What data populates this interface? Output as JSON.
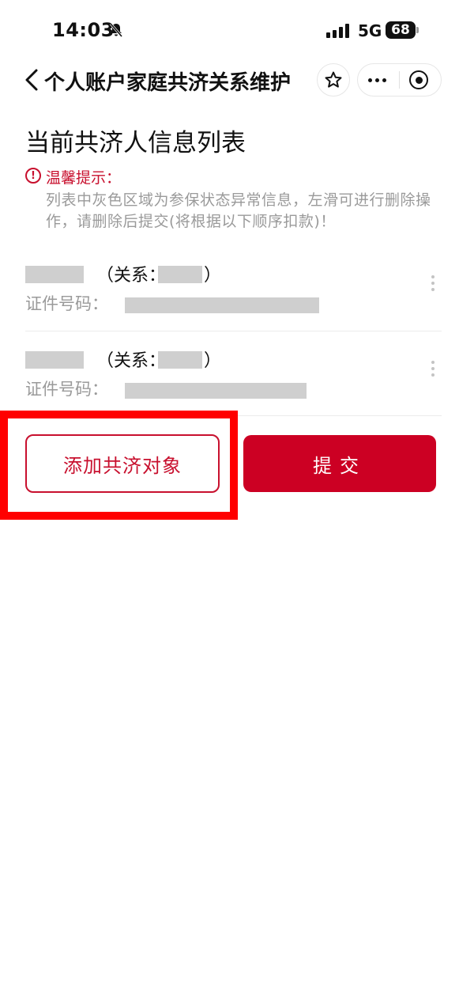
{
  "status_bar": {
    "time": "14:03",
    "network": "5G",
    "battery": "68"
  },
  "nav": {
    "title": "个人账户家庭共济关系维护"
  },
  "main": {
    "title": "当前共济人信息列表",
    "tip_title": "温馨提示：",
    "tip_body": "列表中灰色区域为参保状态异常信息，左滑可进行删除操作，请删除后提交(将根据以下顺序扣款)！",
    "members": [
      {
        "relation_prefix": "（关系：",
        "relation_suffix": "）",
        "id_label": "证件号码："
      },
      {
        "relation_prefix": "（关系：",
        "relation_suffix": "）",
        "id_label": "证件号码："
      }
    ],
    "add_button": "添加共济对象",
    "submit_button": "提交"
  },
  "colors": {
    "accent": "#cc0023",
    "tip_red": "#c8102e",
    "muted_text": "#9a9a9a",
    "mask_gray": "#cfcfcf",
    "highlight": "#ff0000"
  },
  "icons": [
    "bell-off-icon",
    "signal-icon",
    "battery-icon",
    "back-chevron-icon",
    "star-icon",
    "more-icon",
    "target-icon",
    "warning-icon",
    "kebab-icon"
  ]
}
